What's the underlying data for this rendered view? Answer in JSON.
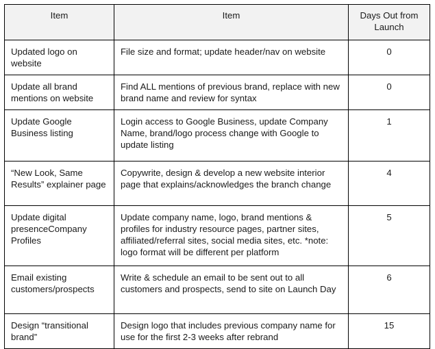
{
  "table": {
    "headers": {
      "col1": "Item",
      "col2": "Item",
      "col3": "Days Out from Launch"
    },
    "rows": [
      {
        "item": "Updated logo on website",
        "description": "File size and format; update header/nav on website",
        "days_out": "0"
      },
      {
        "item": "Update all brand mentions on website",
        "description": "Find ALL mentions of previous brand, replace with new brand name and review for syntax",
        "days_out": "0"
      },
      {
        "item": "Update Google Business listing",
        "description": "Login access to Google Business, update Company Name, brand/logo process change with Google to update listing",
        "days_out": "1"
      },
      {
        "item": "“New Look, Same Results” explainer page",
        "description": "Copywrite, design & develop a new website interior page that explains/acknowledges the branch change",
        "days_out": "4"
      },
      {
        "item": "Update digital presenceCompany Profiles",
        "description": "Update company name, logo, brand mentions & profiles for industry resource pages, partner sites, affiliated/referral sites, social media sites, etc. *note: logo format will be different per platform",
        "days_out": "5"
      },
      {
        "item": "Email existing customers/prospects",
        "description": "Write & schedule an email to be sent out to all customers and prospects, send to site on Launch Day",
        "days_out": "6"
      },
      {
        "item": "Design “transitional brand”",
        "description": "Design logo that includes previous company name for use for the first 2-3 weeks after rebrand",
        "days_out": "15"
      }
    ]
  },
  "colors": {
    "header_background": "#f2f2f2",
    "border": "#000000",
    "text": "#1a1a1a",
    "page_background": "#ffffff"
  }
}
